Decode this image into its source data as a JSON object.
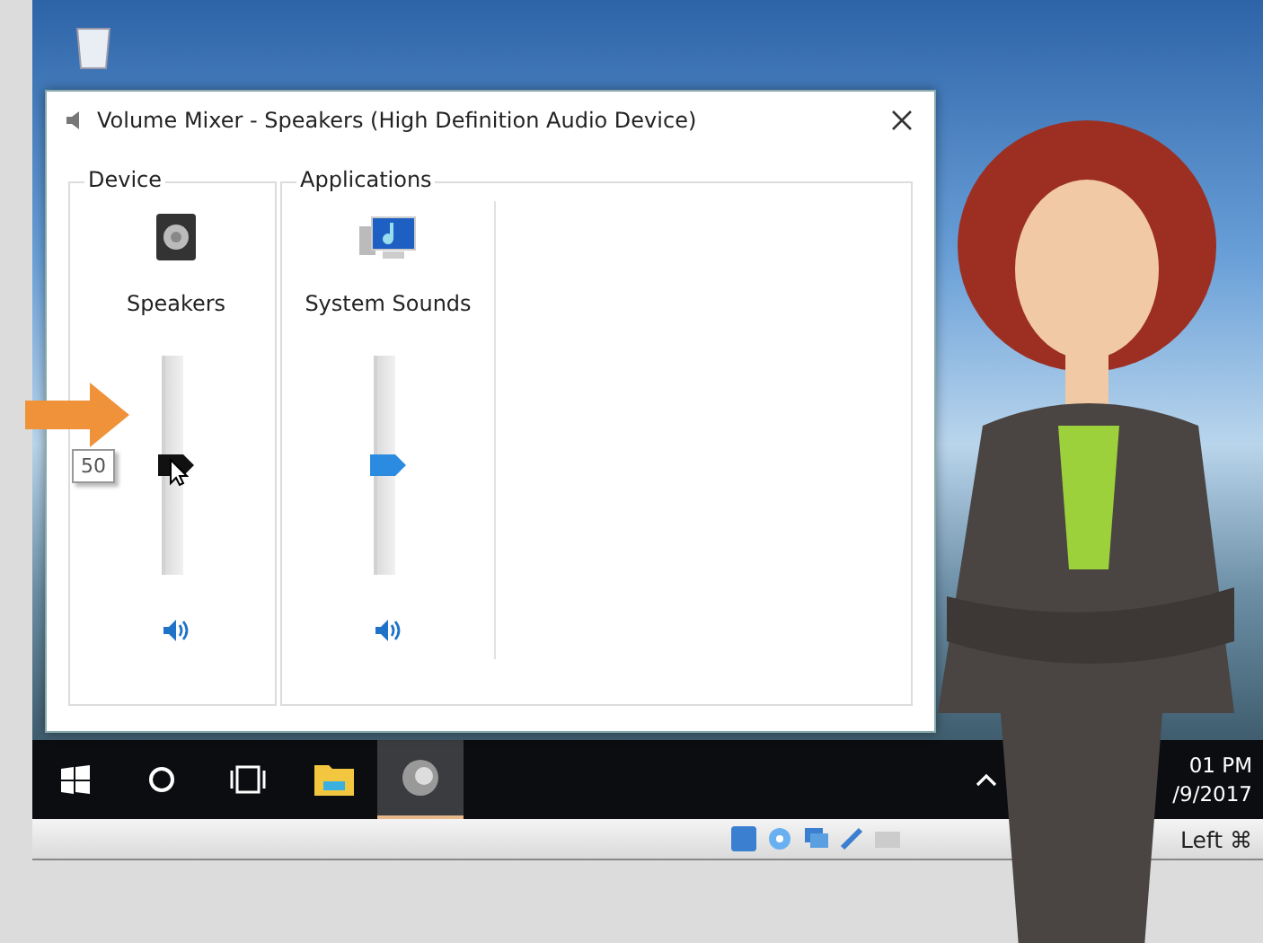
{
  "window": {
    "title": "Volume Mixer - Speakers (High Definition Audio Device)"
  },
  "device": {
    "heading": "Device",
    "channel": {
      "name": "Speakers",
      "level": 0.5,
      "tooltip": "50",
      "muted": false,
      "dragging": true
    }
  },
  "applications": {
    "heading": "Applications",
    "channels": [
      {
        "name": "System Sounds",
        "level": 0.5,
        "muted": false,
        "dragging": false
      }
    ]
  },
  "taskbar": {
    "clock_time": "01 PM",
    "clock_date": "/9/2017"
  },
  "status_bar": {
    "host_key": "Left ⌘"
  }
}
